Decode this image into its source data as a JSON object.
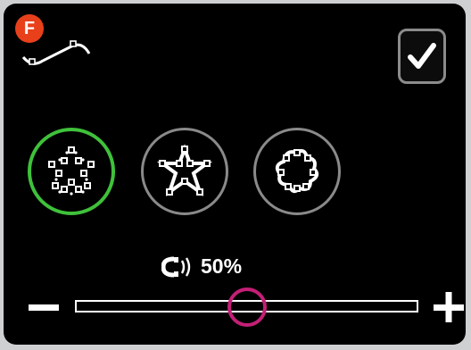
{
  "header": {
    "badge_label": "F",
    "curve_icon": "stitch-curve-icon",
    "confirm_icon": "checkmark-icon"
  },
  "shapes": [
    {
      "name": "round-star",
      "selected": true
    },
    {
      "name": "pointed-star",
      "selected": false
    },
    {
      "name": "flower",
      "selected": false
    }
  ],
  "slider": {
    "value_label": "50%",
    "value_fraction": 0.5,
    "icon": "stitch-density-icon"
  },
  "colors": {
    "badge": "#e8401b",
    "selected_ring": "#3fc13b",
    "thumb": "#c41f76"
  }
}
